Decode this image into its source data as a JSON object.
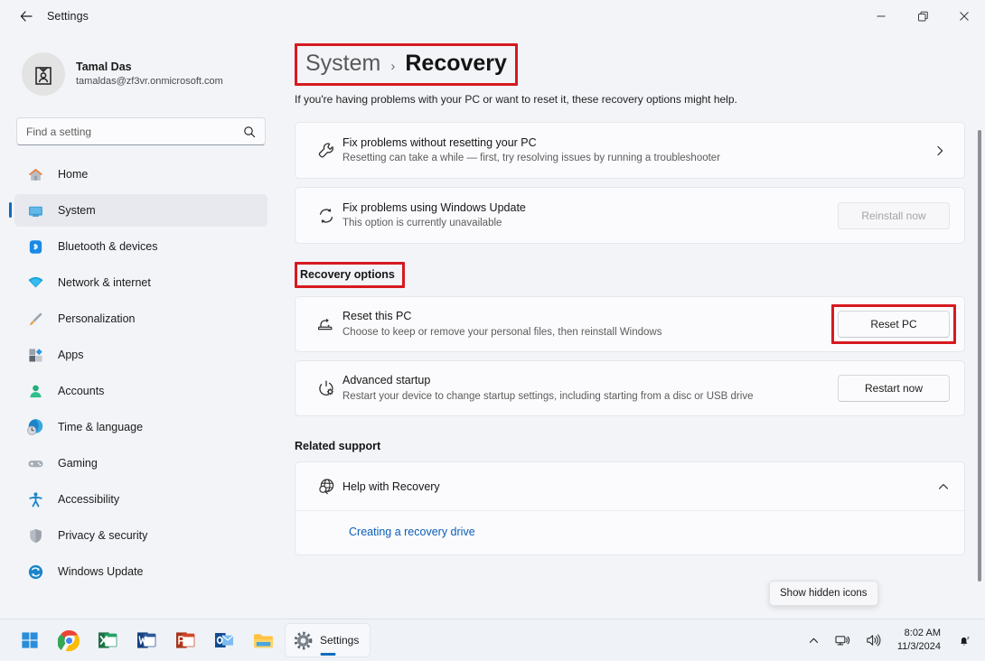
{
  "window": {
    "title": "Settings",
    "back_icon": "back-arrow-icon",
    "minimize_label": "Minimize",
    "maximize_label": "Restore",
    "close_label": "Close"
  },
  "sidebar": {
    "profile": {
      "name": "Tamal Das",
      "email": "tamaldas@zf3vr.onmicrosoft.com",
      "avatar_icon": "user-badge-icon"
    },
    "search": {
      "placeholder": "Find a setting",
      "value": "",
      "icon": "search-icon"
    },
    "items": [
      {
        "label": "Home",
        "icon": "home-icon",
        "active": false
      },
      {
        "label": "System",
        "icon": "system-monitor-icon",
        "active": true
      },
      {
        "label": "Bluetooth & devices",
        "icon": "bluetooth-icon",
        "active": false
      },
      {
        "label": "Network & internet",
        "icon": "wifi-icon",
        "active": false
      },
      {
        "label": "Personalization",
        "icon": "paintbrush-icon",
        "active": false
      },
      {
        "label": "Apps",
        "icon": "apps-icon",
        "active": false
      },
      {
        "label": "Accounts",
        "icon": "account-person-icon",
        "active": false
      },
      {
        "label": "Time & language",
        "icon": "clock-globe-icon",
        "active": false
      },
      {
        "label": "Gaming",
        "icon": "gamepad-icon",
        "active": false
      },
      {
        "label": "Accessibility",
        "icon": "accessibility-person-icon",
        "active": false
      },
      {
        "label": "Privacy & security",
        "icon": "shield-icon",
        "active": false
      },
      {
        "label": "Windows Update",
        "icon": "update-refresh-icon",
        "active": false
      }
    ]
  },
  "main": {
    "breadcrumb": {
      "parent": "System",
      "separator": "›",
      "current": "Recovery"
    },
    "description": "If you're having problems with your PC or want to reset it, these recovery options might help.",
    "top_cards": [
      {
        "title": "Fix problems without resetting your PC",
        "subtitle": "Resetting can take a while — first, try resolving issues by running a troubleshooter",
        "icon": "wrench-icon",
        "action_type": "chevron",
        "action_label": ""
      },
      {
        "title": "Fix problems using Windows Update",
        "subtitle": "This option is currently unavailable",
        "icon": "sync-refresh-icon",
        "action_type": "button-disabled",
        "action_label": "Reinstall now"
      }
    ],
    "recovery_options_heading": "Recovery options",
    "recovery_cards": [
      {
        "title": "Reset this PC",
        "subtitle": "Choose to keep or remove your personal files, then reinstall Windows",
        "icon": "reset-pc-icon",
        "action_type": "button",
        "action_label": "Reset PC"
      },
      {
        "title": "Advanced startup",
        "subtitle": "Restart your device to change startup settings, including starting from a disc or USB drive",
        "icon": "power-gear-icon",
        "action_type": "button",
        "action_label": "Restart now"
      }
    ],
    "related_support_heading": "Related support",
    "expander": {
      "title": "Help with Recovery",
      "icon": "globe-search-icon",
      "chevron": "chevron-up-icon",
      "expanded": true,
      "links": [
        "Creating a recovery drive"
      ]
    }
  },
  "annotations": {
    "color": "#d71920",
    "boxes": [
      "breadcrumb",
      "recovery-options-heading",
      "reset-pc-button"
    ]
  },
  "tooltip": {
    "text": "Show hidden icons"
  },
  "taskbar": {
    "items": [
      {
        "name": "start-button",
        "label": "",
        "icon": "windows-logo-icon"
      },
      {
        "name": "chrome-button",
        "label": "",
        "icon": "chrome-icon"
      },
      {
        "name": "excel-button",
        "label": "",
        "icon": "excel-icon"
      },
      {
        "name": "word-button",
        "label": "",
        "icon": "word-icon"
      },
      {
        "name": "powerpoint-button",
        "label": "",
        "icon": "powerpoint-icon"
      },
      {
        "name": "outlook-button",
        "label": "",
        "icon": "outlook-icon"
      },
      {
        "name": "file-explorer-button",
        "label": "",
        "icon": "folder-icon"
      },
      {
        "name": "settings-button",
        "label": "Settings",
        "icon": "gear-icon"
      }
    ],
    "tray": {
      "show_hidden_icon": "chevron-up-icon",
      "network_icon": "network-icon",
      "volume_icon": "speaker-icon",
      "time": "8:02 AM",
      "date": "11/3/2024",
      "notification_icon": "notification-bell-icon"
    }
  }
}
